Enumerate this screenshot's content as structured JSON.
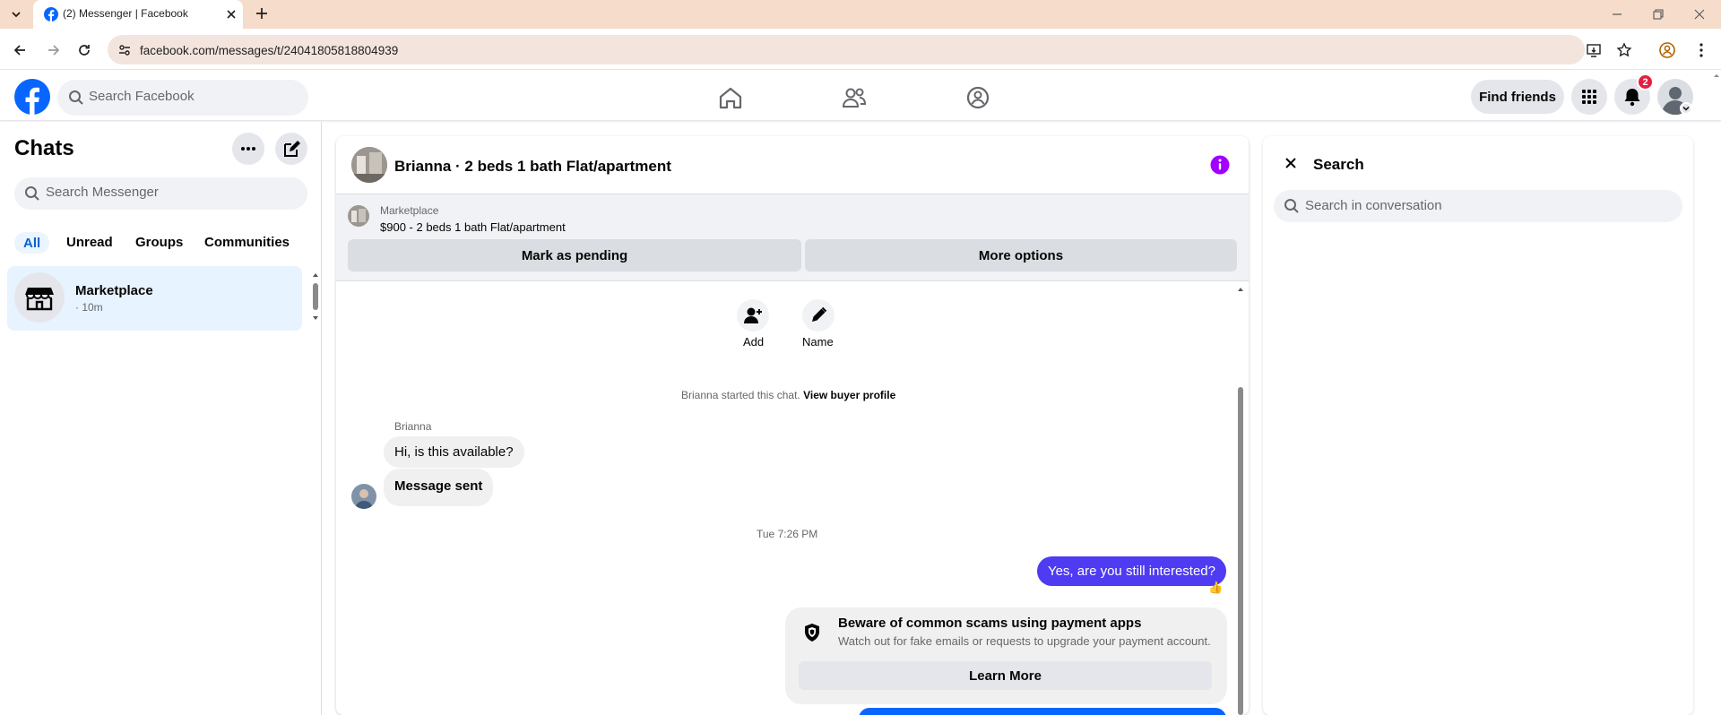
{
  "browser": {
    "tab_title": "(2) Messenger | Facebook",
    "url": "facebook.com/messages/t/24041805818804939"
  },
  "fb": {
    "search_placeholder": "Search Facebook",
    "find_friends": "Find friends",
    "notification_count": "2"
  },
  "chats": {
    "title": "Chats",
    "search_placeholder": "Search Messenger",
    "filters": [
      "All",
      "Unread",
      "Groups",
      "Communities"
    ],
    "items": [
      {
        "name": "Marketplace",
        "meta": "· 10m"
      }
    ]
  },
  "conversation": {
    "title": "Brianna · 2 beds 1 bath Flat/apartment",
    "listing": {
      "source": "Marketplace",
      "summary": "$900 - 2 beds 1 bath Flat/apartment",
      "mark_pending": "Mark as pending",
      "more_options": "More options"
    },
    "actions": {
      "add": "Add",
      "name": "Name"
    },
    "started_text": "Brianna started this chat.",
    "view_profile": "View buyer profile",
    "sender": "Brianna",
    "messages_in": [
      "Hi, is this available?",
      "Message sent"
    ],
    "timestamp": "Tue 7:26 PM",
    "message_out": "Yes, are you still interested?",
    "reaction": "👍",
    "scam_title": "Beware of common scams using payment apps",
    "scam_body": "Watch out for fake emails or requests to upgrade your payment account.",
    "learn_more": "Learn More"
  },
  "search_panel": {
    "title": "Search",
    "placeholder": "Search in conversation"
  },
  "colors": {
    "fb_blue": "#0866ff",
    "out_bubble": "#4e3bf2",
    "badge_red": "#e41e3f",
    "info_purple": "#a100ff"
  }
}
